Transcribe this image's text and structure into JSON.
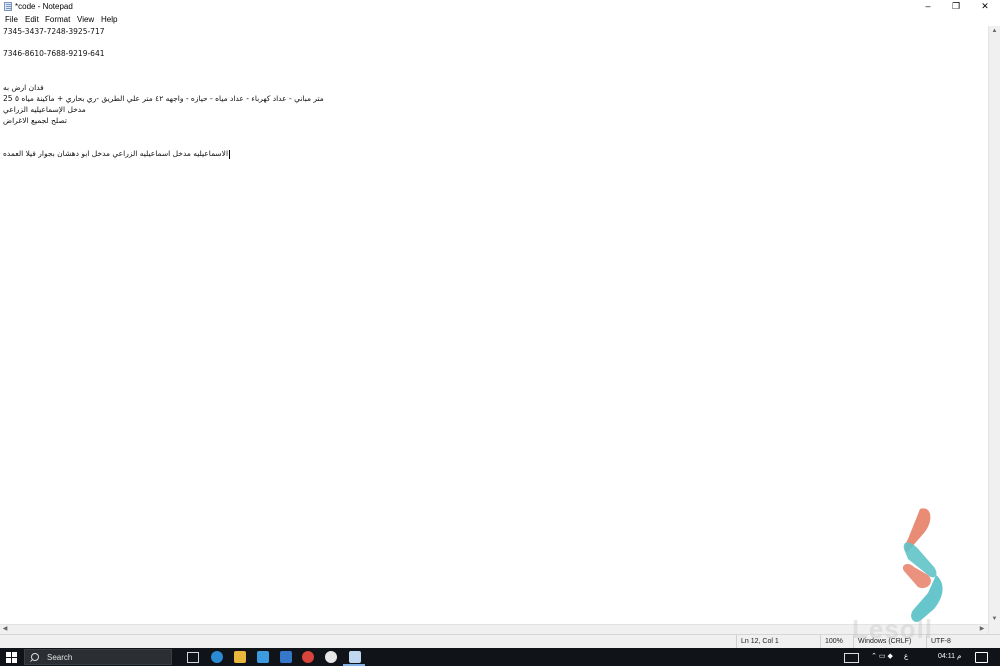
{
  "window": {
    "title": "*code - Notepad",
    "controls": {
      "minimize": "–",
      "maximize": "❐",
      "close": "✕"
    }
  },
  "menu": [
    "File",
    "Edit",
    "Format",
    "View",
    "Help"
  ],
  "editor": {
    "lines": [
      "7345-3437-7248-3925-717",
      "",
      "7346-8610-7688-9219-641",
      "",
      "",
      "",
      "فدان ارض به",
      "متر مباني - عداد كهرباء - عداد مياه - حيازه - واجهه ٤٢ متر علي الطريق -ري بحاري + ماكينة مياه ٥ 25",
      "مدخل الإسماعيليه الزراعي",
      "تصلح لجميع الاغراض",
      "",
      "الاسماعيليه مدخل اسماعيليه الزراعي مدخل ابو دهشان بجوار فيلا العمده"
    ]
  },
  "statusbar": {
    "position": "Ln 12, Col 1",
    "zoom": "100%",
    "line_ending": "Windows (CRLF)",
    "encoding": "UTF-8"
  },
  "taskbar": {
    "search_placeholder": "Search",
    "tray_lang": "ع",
    "tray_time": "04:11 م"
  },
  "watermark": {
    "text": "Lesoll"
  },
  "colors": {
    "taskbar": "#101418",
    "statusbar": "#f0f0f0",
    "logo_salmon": "#e8866f",
    "logo_teal": "#5fc3c8"
  }
}
